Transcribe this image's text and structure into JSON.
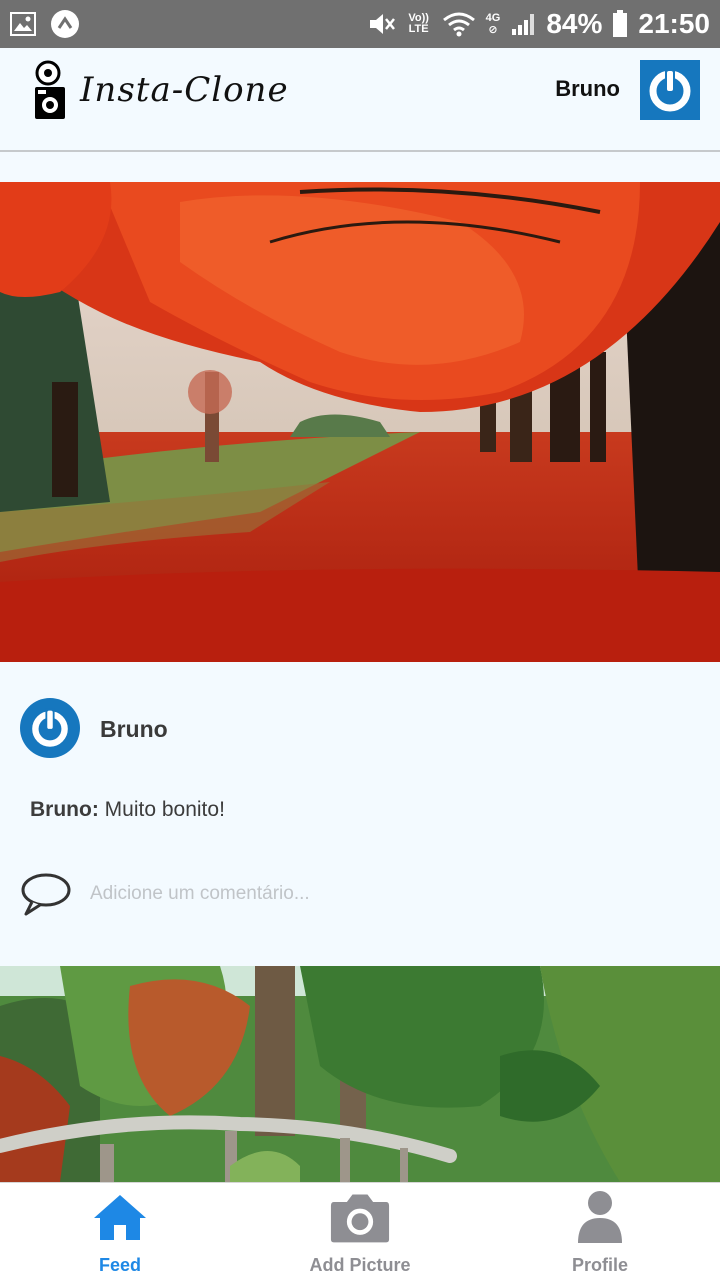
{
  "status_bar": {
    "battery": "84%",
    "time": "21:50",
    "network": "4G",
    "volte": "Vo)) LTE"
  },
  "header": {
    "app_name": "Insta-Clone",
    "user_name": "Bruno"
  },
  "posts": [
    {
      "image": "red-autumn-trees-park",
      "author": "Bruno",
      "comments": [
        {
          "author": "Bruno:",
          "text": "Muito bonito!"
        }
      ],
      "comment_placeholder": "Adicione um comentário..."
    },
    {
      "image": "green-forest-wooden-fence"
    }
  ],
  "tabs": [
    {
      "label": "Feed",
      "icon": "home-icon",
      "active": true
    },
    {
      "label": "Add Picture",
      "icon": "camera-icon",
      "active": false
    },
    {
      "label": "Profile",
      "icon": "person-icon",
      "active": false
    }
  ],
  "colors": {
    "accent": "#1e88e5",
    "avatar_blue": "#1677be",
    "inactive_tab": "#8e8e93",
    "status_bar": "#707070"
  }
}
